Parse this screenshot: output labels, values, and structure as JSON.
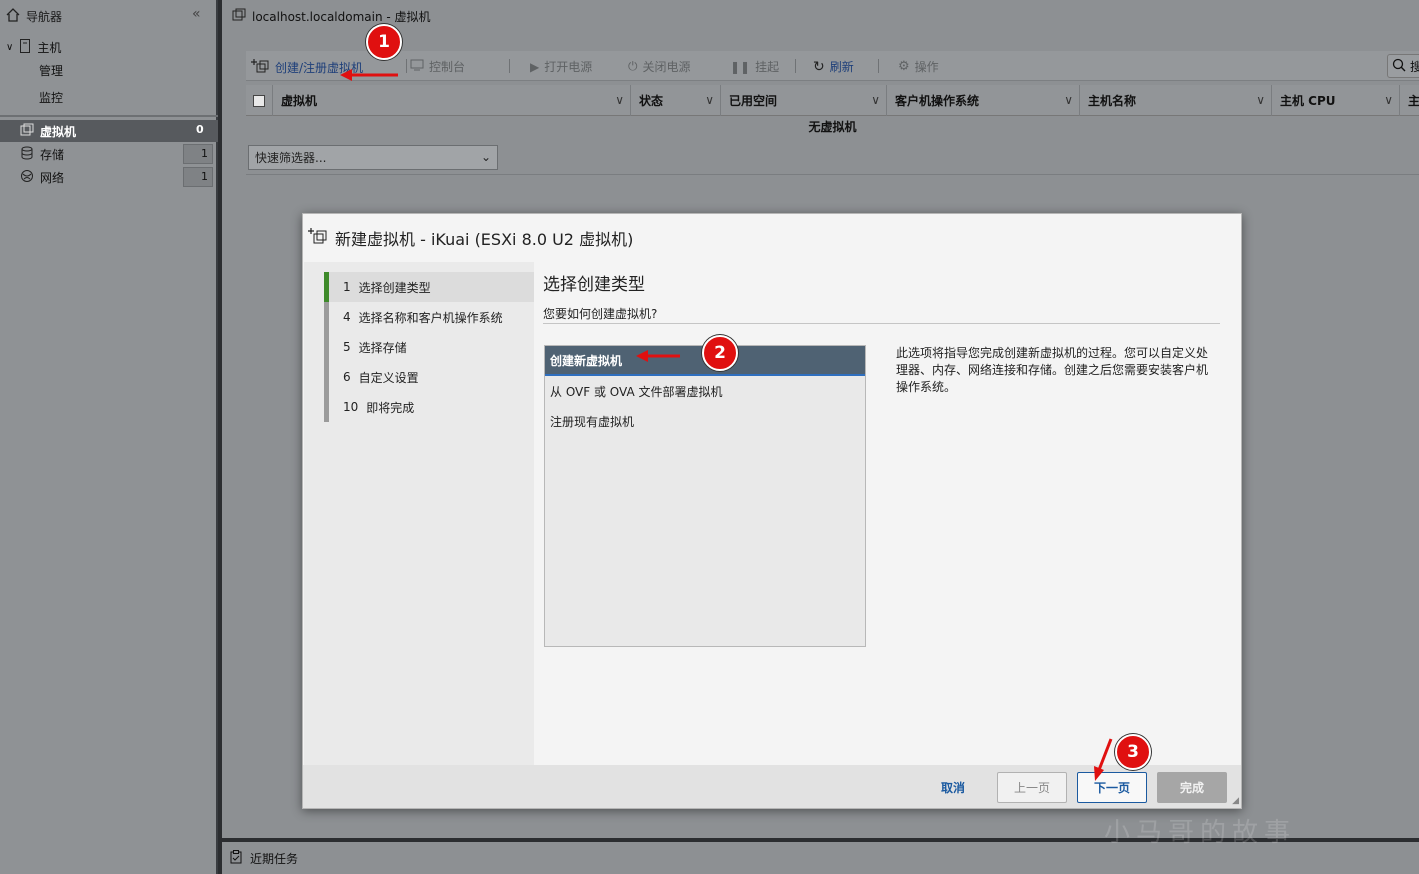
{
  "navigator": {
    "title": "导航器",
    "collapse_icon": "double-chevron-left-icon",
    "host": "主机",
    "host_children": [
      "管理",
      "监控"
    ],
    "items": [
      {
        "label": "虚拟机",
        "count": "0",
        "icon": "vm-icon"
      },
      {
        "label": "存储",
        "count": "1",
        "icon": "storage-icon"
      },
      {
        "label": "网络",
        "count": "1",
        "icon": "network-icon"
      }
    ]
  },
  "main": {
    "title": "localhost.localdomain - 虚拟机",
    "toolbar": {
      "create": "创建/注册虚拟机",
      "console": "控制台",
      "power_on": "打开电源",
      "power_off": "关闭电源",
      "suspend": "挂起",
      "refresh": "刷新",
      "actions": "操作",
      "search": "搜索"
    },
    "columns": [
      "虚拟机",
      "状态",
      "已用空间",
      "客户机操作系统",
      "主机名称",
      "主机 CPU",
      "主"
    ],
    "empty_text": "无虚拟机",
    "quick_filter": "快速筛选器..."
  },
  "bottom": {
    "label": "近期任务"
  },
  "modal": {
    "title": "新建虚拟机 - iKuai (ESXi 8.0 U2 虚拟机)",
    "steps": [
      {
        "num": "1",
        "label": "选择创建类型",
        "active": true
      },
      {
        "num": "4",
        "label": "选择名称和客户机操作系统"
      },
      {
        "num": "5",
        "label": "选择存储"
      },
      {
        "num": "6",
        "label": "自定义设置"
      },
      {
        "num": "10",
        "label": "即将完成"
      }
    ],
    "heading": "选择创建类型",
    "subheading": "您要如何创建虚拟机?",
    "options": [
      "创建新虚拟机",
      "从 OVF 或 OVA 文件部署虚拟机",
      "注册现有虚拟机"
    ],
    "selected_option": 0,
    "description": "此选项将指导您完成创建新虚拟机的过程。您可以自定义处理器、内存、网络连接和存储。创建之后您需要安装客户机操作系统。",
    "buttons": {
      "cancel": "取消",
      "prev": "上一页",
      "next": "下一页",
      "finish": "完成"
    }
  },
  "annotations": {
    "markers": [
      "1",
      "2",
      "3"
    ],
    "color": "#e01010"
  },
  "watermark": "小马哥的故事"
}
